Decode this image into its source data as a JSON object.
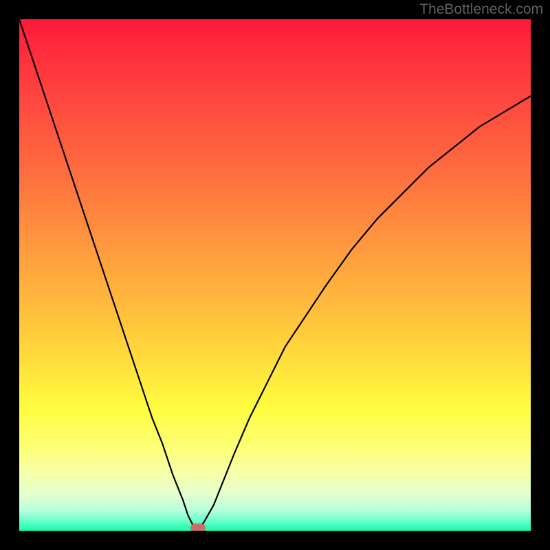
{
  "watermark": "TheBottleneck.com",
  "colors": {
    "background": "#000000",
    "curve_stroke": "#000000",
    "marker_fill": "#cc6e67",
    "watermark_text": "#5f5f5f"
  },
  "chart_data": {
    "type": "line",
    "title": "",
    "xlabel": "",
    "ylabel": "",
    "xlim": [
      0,
      100
    ],
    "ylim": [
      0,
      100
    ],
    "grid": false,
    "x": [
      0,
      2,
      4,
      6,
      8,
      10,
      12,
      14,
      16,
      18,
      20,
      22,
      24,
      26,
      28,
      30,
      32,
      33,
      34,
      35,
      36,
      38,
      40,
      42,
      45,
      48,
      52,
      56,
      60,
      65,
      70,
      75,
      80,
      85,
      90,
      95,
      100
    ],
    "values": [
      100,
      94,
      88,
      82,
      76,
      70,
      64,
      58,
      52,
      46,
      40,
      34,
      28,
      22,
      17,
      11,
      6,
      3,
      1,
      0.5,
      1.5,
      5,
      10,
      15,
      22,
      28,
      36,
      42,
      48,
      55,
      61,
      66,
      71,
      75,
      79,
      82,
      85
    ],
    "marker": {
      "x": 35,
      "y": 0.5
    },
    "background_gradient": {
      "direction": "vertical",
      "stops": [
        {
          "pos": 0.0,
          "color": "#fe1938"
        },
        {
          "pos": 0.29,
          "color": "#fe6b3f"
        },
        {
          "pos": 0.54,
          "color": "#ffb53d"
        },
        {
          "pos": 0.76,
          "color": "#fffc3f"
        },
        {
          "pos": 0.93,
          "color": "#e2ffce"
        },
        {
          "pos": 1.0,
          "color": "#10ffad"
        }
      ]
    }
  }
}
